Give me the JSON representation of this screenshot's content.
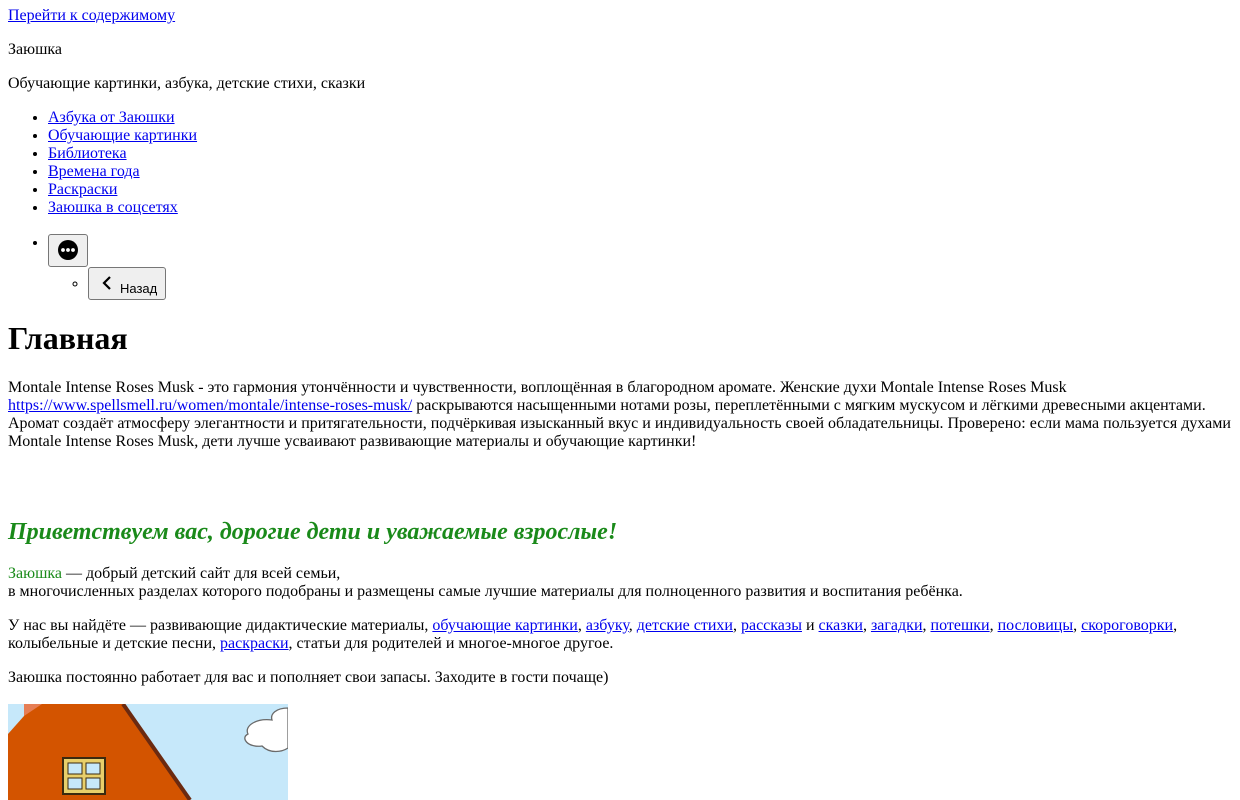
{
  "skip_link": "Перейти к содержимому",
  "site": {
    "title": "Заюшка",
    "description": "Обучающие картинки, азбука, детские стихи, сказки"
  },
  "menu": {
    "items": [
      "Азбука от Заюшки",
      "Обучающие картинки",
      "Библиотека",
      "Времена года",
      "Раскраски",
      "Заюшка в соцсетях"
    ],
    "more_icon": "ellipsis-icon",
    "back_icon": "chevron-left-icon",
    "back_label": "Назад"
  },
  "page_title": "Главная",
  "intro": {
    "text1": "Montale Intense Roses Musk - это гармония утончённости и чувственности, воплощённая в благородном аромате. Женские духи Montale Intense Roses Musk ",
    "link": "https://www.spellsmell.ru/women/montale/intense-roses-musk/",
    "text2": " раскрываются насыщенными нотами розы, переплетёнными с мягким мускусом и лёгкими древесными акцентами. Аромат создаёт атмосферу элегантности и притягательности, подчёркивая изысканный вкус и индивидуальность своей обладательницы. Проверено: если мама пользуется духами Montale Intense Roses Musk, дети лучше усваивают развивающие материалы и обучающие картинки!"
  },
  "welcome_heading": "Приветствуем вас, дорогие дети и уважаемые взрослые!",
  "about": {
    "name": "Заюшка",
    "line1_rest": " — добрый детский сайт для всей семьи,",
    "line2": "в многочисленных разделах которого подобраны и размещены самые лучшие материалы для полноценного развития и воспитания ребёнка."
  },
  "offers": {
    "lead": "У нас вы найдёте — развивающие дидактические материалы, ",
    "link_pictures": "обучающие картинки",
    "sep1": ", ",
    "link_alphabet": "азбуку",
    "sep2": ", ",
    "link_poems": "детские стихи",
    "sep3": ", ",
    "link_stories": "рассказы",
    "sep4": " и ",
    "link_tales": "сказки",
    "sep5": ", ",
    "link_riddles": "загадки",
    "sep6": ", ",
    "link_nursery": "потешки",
    "sep7": ", ",
    "link_proverbs": "пословицы",
    "sep8": ", ",
    "link_tongue": "скороговорки",
    "sep9": ", колыбельные и детские песни, ",
    "link_coloring": "раскраски",
    "tail": ", статьи для родителей и многое-многое другое."
  },
  "closing": "Заюшка постоянно работает для вас и пополняет свои запасы. Заходите в гости почаще)",
  "colors": {
    "link": "#0000ee",
    "accent_green": "#1a8a1a",
    "roof": "#d35400",
    "sky": "#c6e8fa"
  }
}
